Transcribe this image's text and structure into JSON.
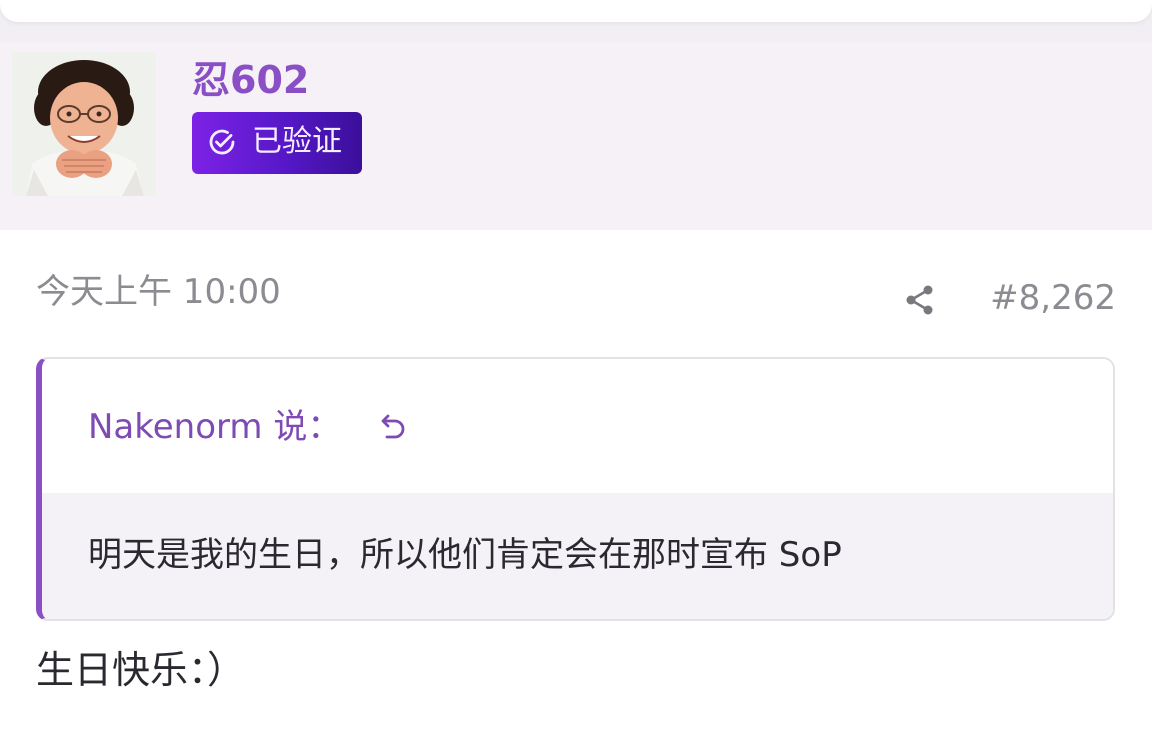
{
  "user": {
    "name": "忍602",
    "badge_label": "已验证",
    "badge_icon": "check-circle-icon",
    "badge_colors": [
      "#7d22e6",
      "#3a0f9a"
    ],
    "name_color": "#8a4fc4"
  },
  "post": {
    "time": "今天上午 10:00",
    "number": "#8,262",
    "share_icon": "share-icon",
    "body": "生日快乐：）"
  },
  "quote": {
    "author_label": "Nakenorm 说：",
    "jump_icon": "jump-to-quote-icon",
    "text": "明天是我的生日，所以他们肯定会在那时宣布 SoP",
    "accent_color": "#8a4fc4"
  }
}
